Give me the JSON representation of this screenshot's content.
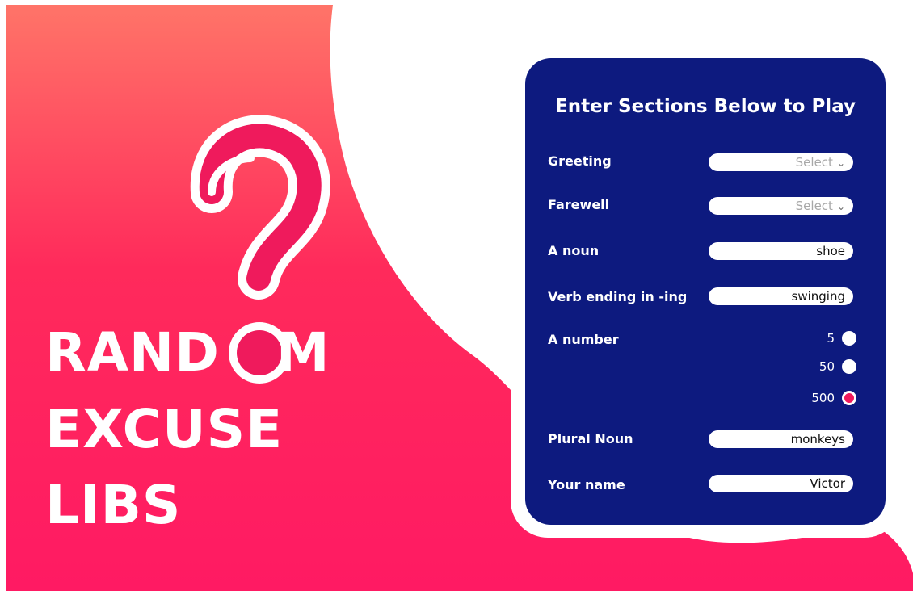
{
  "hero": {
    "title_line1_a": "RAND",
    "title_line1_b": "M",
    "title_line2": "EXCUSE",
    "title_line3": "LIBS",
    "question_mark_icon": "question-mark-icon"
  },
  "colors": {
    "gradient_top": "#ff7468",
    "gradient_mid": "#ff2a5b",
    "gradient_bottom": "#ff1a63",
    "accent_pink": "#ef1a5c",
    "panel_navy": "#0d1a7f",
    "white": "#ffffff"
  },
  "form": {
    "title": "Enter Sections Below to Play",
    "greeting": {
      "label": "Greeting",
      "value": "Select",
      "icon": "chevron-down-icon"
    },
    "farewell": {
      "label": "Farewell",
      "value": "Select",
      "icon": "chevron-down-icon"
    },
    "noun": {
      "label": "A noun",
      "value": "shoe"
    },
    "verb": {
      "label": "Verb ending in -ing",
      "value": "swinging"
    },
    "number": {
      "label": "A number",
      "options": [
        {
          "label": "5",
          "selected": false
        },
        {
          "label": "50",
          "selected": false
        },
        {
          "label": "500",
          "selected": true
        }
      ]
    },
    "plural_noun": {
      "label": "Plural Noun",
      "value": "monkeys"
    },
    "your_name": {
      "label": "Your name",
      "value": "Victor"
    }
  }
}
